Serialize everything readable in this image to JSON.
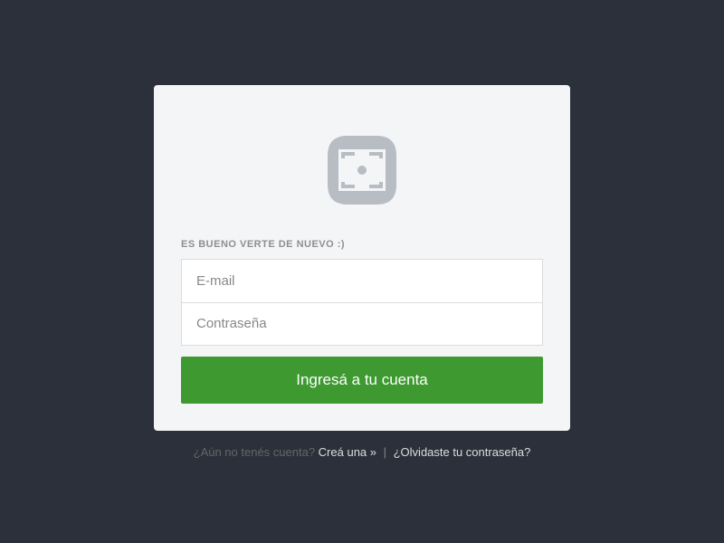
{
  "welcome": "ES BUENO VERTE DE NUEVO :)",
  "email": {
    "placeholder": "E-mail"
  },
  "password": {
    "placeholder": "Contraseña"
  },
  "submit": "Ingresá a tu cuenta",
  "footer": {
    "prompt": "¿Aún no tenés cuenta? ",
    "create": "Creá una »",
    "sep": " | ",
    "forgot": "¿Olvidaste tu contraseña?"
  }
}
